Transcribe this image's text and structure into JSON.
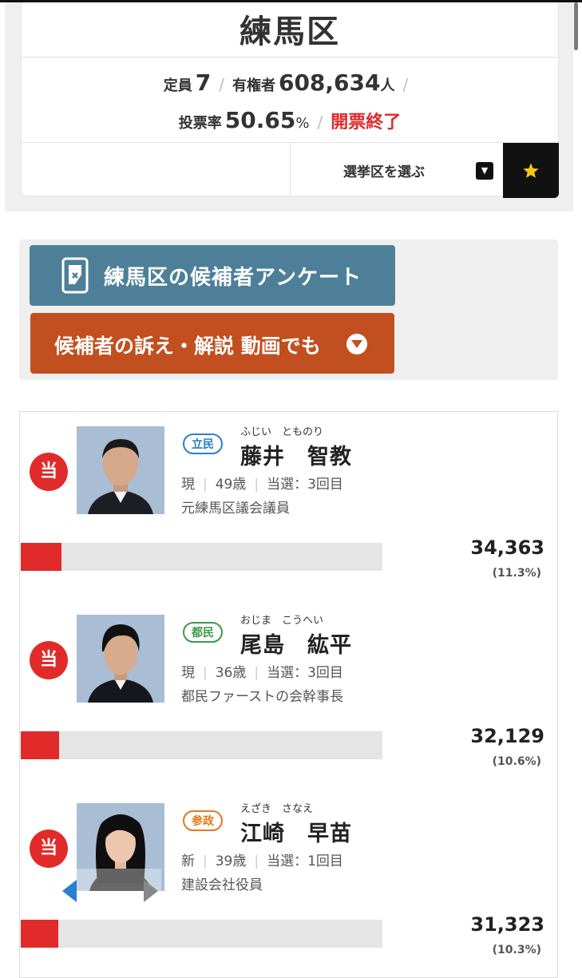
{
  "header": {
    "district_name": "練馬区",
    "seats_label": "定員",
    "seats_value": "7",
    "electorate_label": "有権者",
    "electorate_value": "608,634",
    "electorate_unit": "人",
    "turnout_label": "投票率",
    "turnout_value": "50.65",
    "turnout_unit": "%",
    "count_status": "開票終了",
    "status_color": "#e0292a",
    "separator": "/",
    "select_district_label": "選挙区を選ぶ",
    "select_arrow_icon": "triangle-down-icon",
    "favorite_icon": "star-icon"
  },
  "actions": {
    "survey_label": "練馬区の候補者アンケート",
    "survey_color": "#4d8098",
    "video_label": "候補者の訴え・解説 動画でも",
    "video_color": "#c14f1f"
  },
  "candidates": [
    {
      "elected_badge": "当",
      "party": "立民",
      "party_color": "#2a7fd0",
      "kana": "ふじい　とものり",
      "name": "藤井　智教",
      "status": "現",
      "age": "49歳",
      "terms": "当選：3回目",
      "career": "元練馬区議会議員",
      "votes": "34,363",
      "percent": "(11.3%)",
      "share": 11.3
    },
    {
      "elected_badge": "当",
      "party": "都民",
      "party_color": "#3a9a4a",
      "kana": "おじま　こうへい",
      "name": "尾島　紘平",
      "status": "現",
      "age": "36歳",
      "terms": "当選：3回目",
      "career": "都民ファーストの会幹事長",
      "votes": "32,129",
      "percent": "(10.6%)",
      "share": 10.6
    },
    {
      "elected_badge": "当",
      "party": "参政",
      "party_color": "#e07a1e",
      "kana": "えざき　さなえ",
      "name": "江崎　早苗",
      "status": "新",
      "age": "39歳",
      "terms": "当選：1回目",
      "career": "建設会社役員",
      "votes": "31,323",
      "percent": "(10.3%)",
      "share": 10.3
    }
  ],
  "winner_color": "#e02b2a"
}
